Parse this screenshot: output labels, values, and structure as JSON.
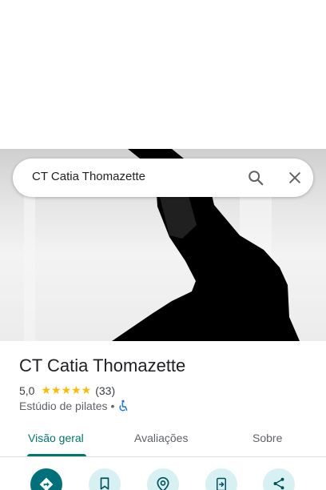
{
  "search": {
    "query": "CT Catia Thomazette"
  },
  "place": {
    "name": "CT Catia Thomazette",
    "rating": "5,0",
    "stars": "★★★★★",
    "review_count": "(33)",
    "category": "Estúdio de pilates",
    "separator": "•"
  },
  "tabs": [
    {
      "label": "Visão geral",
      "active": true
    },
    {
      "label": "Avaliações",
      "active": false
    },
    {
      "label": "Sobre",
      "active": false
    }
  ],
  "actions": [
    {
      "icon": "directions-icon"
    },
    {
      "icon": "bookmark-icon"
    },
    {
      "icon": "nearby-icon"
    },
    {
      "icon": "send-to-phone-icon"
    },
    {
      "icon": "share-icon"
    }
  ],
  "colors": {
    "accent": "#00786f",
    "star": "#fbbc04",
    "accessibility": "#1a73e8",
    "action_bg": "#d7f0f2"
  }
}
